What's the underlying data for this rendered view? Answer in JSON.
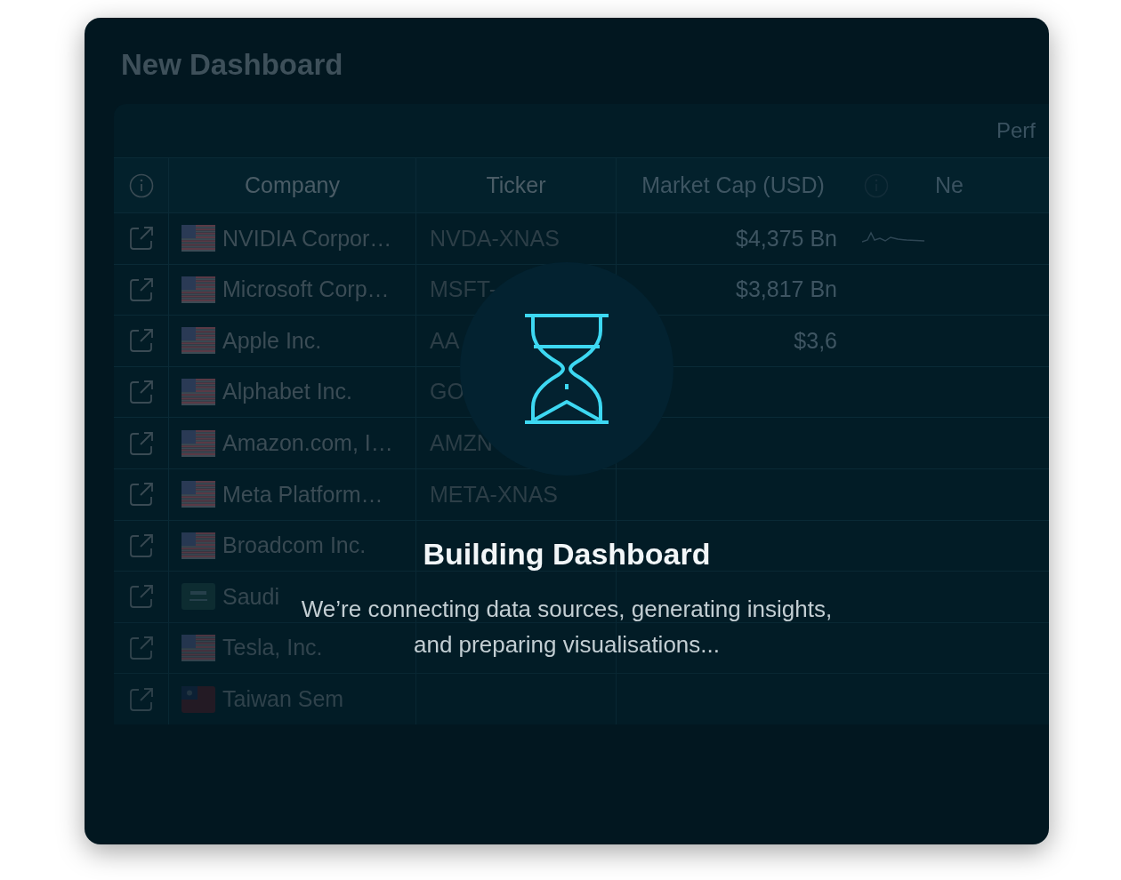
{
  "title": "New Dashboard",
  "table": {
    "group_header": "Perf",
    "columns": [
      "Company",
      "Ticker",
      "Market Cap (USD)",
      "Ne"
    ],
    "rows": [
      {
        "kind": "us",
        "company": "NVIDIA Corpor…",
        "ticker": "NVDA-XNAS",
        "market_cap": "$4,375 Bn",
        "trend": true
      },
      {
        "kind": "us",
        "company": "Microsoft Corp…",
        "ticker": "MSFT-",
        "market_cap": "$3,817 Bn",
        "trend": false
      },
      {
        "kind": "us",
        "company": "Apple Inc.",
        "ticker": "AA",
        "market_cap": "$3,6",
        "trend": false
      },
      {
        "kind": "us",
        "company": "Alphabet Inc.",
        "ticker": "GO",
        "trend": false
      },
      {
        "kind": "us",
        "company": "Amazon.com, I…",
        "ticker": "AMZN",
        "trend": false
      },
      {
        "kind": "us",
        "company": "Meta Platform…",
        "ticker": "META-XNAS",
        "trend": false
      },
      {
        "kind": "us",
        "company": "Broadcom Inc.",
        "trend": false
      },
      {
        "kind": "sa",
        "company": "Saudi",
        "trend": false
      },
      {
        "kind": "us",
        "company": "Tesla, Inc.",
        "trend": false
      },
      {
        "kind": "tw",
        "company": "Taiwan Sem",
        "trend": false
      }
    ]
  },
  "loading": {
    "title": "Building Dashboard",
    "message_lines": [
      "We’re connecting data sources, generating insights,",
      "and preparing visualisations..."
    ]
  }
}
